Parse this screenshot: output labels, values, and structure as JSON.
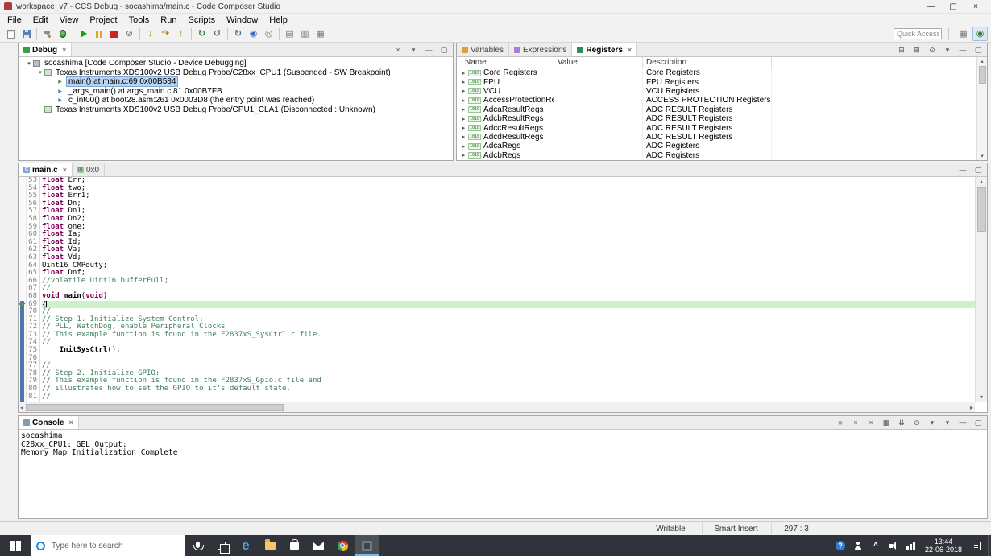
{
  "window": {
    "title": "workspace_v7 - CCS Debug - socashima/main.c - Code Composer Studio"
  },
  "titlebar": {
    "controls": [
      {
        "name": "minimize-button",
        "glyph": "—"
      },
      {
        "name": "maximize-button",
        "glyph": "▢"
      },
      {
        "name": "close-button",
        "glyph": "×"
      }
    ]
  },
  "menubar": {
    "items": [
      "File",
      "Edit",
      "View",
      "Project",
      "Tools",
      "Run",
      "Scripts",
      "Window",
      "Help"
    ]
  },
  "toolbar": {
    "quick_access_placeholder": "Quick Access",
    "groups": [
      [
        {
          "name": "new-button",
          "cls": "i-new"
        },
        {
          "name": "save-button",
          "cls": "i-save"
        }
      ],
      [
        {
          "name": "build-button",
          "cls": "i-hammer"
        },
        {
          "name": "debug-button",
          "cls": "i-bug"
        }
      ],
      [
        {
          "name": "resume-button",
          "cls": "i-play"
        },
        {
          "name": "suspend-button",
          "cls": "i-pause"
        },
        {
          "name": "terminate-button",
          "cls": "i-stop"
        },
        {
          "name": "disconnect-button",
          "glyph": "⊘",
          "color": "#8a8a8a"
        }
      ],
      [
        {
          "name": "step-into-button",
          "glyph": "↓",
          "color": "#b8860b"
        },
        {
          "name": "step-over-button",
          "glyph": "↷",
          "color": "#b8860b"
        },
        {
          "name": "step-return-button",
          "glyph": "↑",
          "color": "#b8860b"
        }
      ],
      [
        {
          "name": "restart-button",
          "glyph": "↻",
          "color": "#2e7d32"
        },
        {
          "name": "cpu-reset-button",
          "glyph": "↺",
          "color": "#666666"
        }
      ],
      [
        {
          "name": "refresh-button",
          "glyph": "↻",
          "color": "#4a6ea9"
        },
        {
          "name": "breakpoints-button",
          "glyph": "◉",
          "color": "#3a6fb5"
        },
        {
          "name": "watchpoint-button",
          "glyph": "◎",
          "color": "#777777"
        }
      ],
      [
        {
          "name": "memory-browser-button",
          "glyph": "▤",
          "color": "#777777"
        },
        {
          "name": "registers-view-button",
          "glyph": "▥",
          "color": "#777777"
        },
        {
          "name": "expressions-view-button",
          "glyph": "▦",
          "color": "#777777"
        }
      ]
    ],
    "perspectives": [
      {
        "name": "perspective-ccs-edit-button",
        "glyph": "▦",
        "color": "#777777",
        "active": false
      },
      {
        "name": "perspective-ccs-debug-button",
        "glyph": "◉",
        "color": "#2e7d32",
        "active": true
      }
    ]
  },
  "left_strip": {
    "icons": [
      {
        "name": "restore-views-button",
        "glyph": "◧"
      },
      {
        "name": "minimized-view-button-1",
        "glyph": "▤"
      },
      {
        "name": "minimized-view-button-2",
        "glyph": "▦"
      }
    ]
  },
  "debug_panel": {
    "tab": "Debug",
    "header_icons": [
      {
        "name": "remove-terminated-button",
        "glyph": "×"
      },
      {
        "name": "view-menu-button",
        "glyph": "▾"
      },
      {
        "name": "minimize-button",
        "glyph": "—"
      },
      {
        "name": "maximize-button",
        "glyph": "▢"
      }
    ],
    "tree": [
      {
        "indent": 0,
        "expander": "▾",
        "icon": "debug-target-icon",
        "selected": false,
        "text": "socashima [Code Composer Studio - Device Debugging]"
      },
      {
        "indent": 1,
        "expander": "▾",
        "icon": "cpu-probe-icon",
        "selected": false,
        "text": "Texas Instruments XDS100v2 USB Debug Probe/C28xx_CPU1 (Suspended - SW Breakpoint)"
      },
      {
        "indent": 2,
        "expander": "",
        "icon": "stack-frame-current-icon",
        "selected": true,
        "text": "main() at main.c:69 0x00B584"
      },
      {
        "indent": 2,
        "expander": "",
        "icon": "stack-frame-icon",
        "selected": false,
        "text": "_args_main() at args_main.c:81 0x00B7FB"
      },
      {
        "indent": 2,
        "expander": "",
        "icon": "stack-frame-icon",
        "selected": false,
        "text": "c_int00() at boot28.asm:261 0x0003D8 (the entry point was reached)"
      },
      {
        "indent": 1,
        "expander": "",
        "icon": "cpu-probe-icon",
        "selected": false,
        "text": "Texas Instruments XDS100v2 USB Debug Probe/CPU1_CLA1 (Disconnected : Unknown)"
      }
    ]
  },
  "registers_panel": {
    "tabs": [
      {
        "label": "Variables",
        "icon": "variables-icon",
        "active": false
      },
      {
        "label": "Expressions",
        "icon": "expressions-icon",
        "active": false
      },
      {
        "label": "Registers",
        "icon": "registers-icon",
        "active": true
      }
    ],
    "header_icons": [
      {
        "name": "collapse-all-button",
        "glyph": "⊟"
      },
      {
        "name": "expand-all-button",
        "glyph": "⊞"
      },
      {
        "name": "pin-view-button",
        "glyph": "⊙"
      },
      {
        "name": "view-menu-button",
        "glyph": "▾"
      },
      {
        "name": "minimize-button",
        "glyph": "—"
      },
      {
        "name": "maximize-button",
        "glyph": "▢"
      }
    ],
    "columns": [
      "Name",
      "Value",
      "Description"
    ],
    "rows": [
      {
        "name": "Core Registers",
        "value": "",
        "description": "Core Registers"
      },
      {
        "name": "FPU",
        "value": "",
        "description": "FPU Registers"
      },
      {
        "name": "VCU",
        "value": "",
        "description": "VCU Registers"
      },
      {
        "name": "AccessProtectionRegs",
        "value": "",
        "description": "ACCESS PROTECTION Registers"
      },
      {
        "name": "AdcaResultRegs",
        "value": "",
        "description": "ADC RESULT Registers"
      },
      {
        "name": "AdcbResultRegs",
        "value": "",
        "description": "ADC RESULT Registers"
      },
      {
        "name": "AdccResultRegs",
        "value": "",
        "description": "ADC RESULT Registers"
      },
      {
        "name": "AdcdResultRegs",
        "value": "",
        "description": "ADC RESULT Registers"
      },
      {
        "name": "AdcaRegs",
        "value": "",
        "description": "ADC Registers"
      },
      {
        "name": "AdcbRegs",
        "value": "",
        "description": "ADC Registers"
      }
    ]
  },
  "editor": {
    "tabs": [
      {
        "label": "main.c",
        "icon": "c-file-icon",
        "active": true,
        "closable": true
      },
      {
        "label": "0x0",
        "icon": "disassembly-icon",
        "active": false,
        "closable": false
      }
    ],
    "header_icons": [
      {
        "name": "minimize-button",
        "glyph": "—"
      },
      {
        "name": "maximize-button",
        "glyph": "▢"
      }
    ],
    "lines": [
      {
        "n": 53,
        "t": "float Err;",
        "current": false
      },
      {
        "n": 54,
        "t": "float two;",
        "current": false
      },
      {
        "n": 55,
        "t": "float Err1;",
        "current": false
      },
      {
        "n": 56,
        "t": "float Dn;",
        "current": false
      },
      {
        "n": 57,
        "t": "float Dn1;",
        "current": false
      },
      {
        "n": 58,
        "t": "float Dn2;",
        "current": false
      },
      {
        "n": 59,
        "t": "float one;",
        "current": false
      },
      {
        "n": 60,
        "t": "float Ia;",
        "current": false
      },
      {
        "n": 61,
        "t": "float Id;",
        "current": false
      },
      {
        "n": 62,
        "t": "float Va;",
        "current": false
      },
      {
        "n": 63,
        "t": "float Vd;",
        "current": false
      },
      {
        "n": 64,
        "t": "Uint16 CMPduty;",
        "current": false
      },
      {
        "n": 65,
        "t": "float Dnf;",
        "current": false
      },
      {
        "n": 66,
        "t": "//volatile Uint16 bufferFull;",
        "current": false
      },
      {
        "n": 67,
        "t": "//",
        "current": false
      },
      {
        "n": 68,
        "t": "void main(void)",
        "current": false
      },
      {
        "n": 69,
        "t": "{",
        "current": true
      },
      {
        "n": 70,
        "t": "//",
        "current": false
      },
      {
        "n": 71,
        "t": "// Step 1. Initialize System Control:",
        "current": false
      },
      {
        "n": 72,
        "t": "// PLL, WatchDog, enable Peripheral Clocks",
        "current": false
      },
      {
        "n": 73,
        "t": "// This example function is found in the F2837xS_SysCtrl.c file.",
        "current": false
      },
      {
        "n": 74,
        "t": "//",
        "current": false
      },
      {
        "n": 75,
        "t": "    InitSysCtrl();",
        "current": false
      },
      {
        "n": 76,
        "t": "",
        "current": false
      },
      {
        "n": 77,
        "t": "//",
        "current": false
      },
      {
        "n": 78,
        "t": "// Step 2. Initialize GPIO:",
        "current": false
      },
      {
        "n": 79,
        "t": "// This example function is found in the F2837xS_Gpio.c file and",
        "current": false
      },
      {
        "n": 80,
        "t": "// illustrates how to set the GPIO to it's default state.",
        "current": false
      },
      {
        "n": 81,
        "t": "//",
        "current": false
      }
    ]
  },
  "console": {
    "tab": "Console",
    "header_icons": [
      {
        "name": "terminate-button",
        "glyph": "■",
        "color": "#c49a9a"
      },
      {
        "name": "remove-launch-button",
        "glyph": "×"
      },
      {
        "name": "remove-all-launches-button",
        "glyph": "×"
      },
      {
        "name": "clear-console-button",
        "glyph": "▦"
      },
      {
        "name": "scroll-lock-button",
        "glyph": "⇊"
      },
      {
        "name": "pin-console-button",
        "glyph": "⊙"
      },
      {
        "name": "console-display-button",
        "glyph": "▾"
      },
      {
        "name": "open-console-button",
        "glyph": "▾"
      },
      {
        "name": "minimize-button",
        "glyph": "—"
      },
      {
        "name": "maximize-button",
        "glyph": "▢"
      }
    ],
    "lines": [
      "socashima",
      "C28xx_CPU1: GEL Output:",
      "Memory Map Initialization Complete"
    ]
  },
  "statusbar": {
    "writable": "Writable",
    "insert_mode": "Smart Insert",
    "caret_position": "297 : 3"
  },
  "taskbar": {
    "search_placeholder": "Type here to search",
    "icons": [
      {
        "name": "mic-button",
        "cls": "tb-mic",
        "active": false
      },
      {
        "name": "task-view-button",
        "cls": "tb-taskview",
        "active": false
      },
      {
        "name": "edge-button",
        "cls": "tb-edge",
        "label": "e",
        "active": false
      },
      {
        "name": "file-explorer-button",
        "cls": "tb-folder",
        "active": false
      },
      {
        "name": "store-button",
        "cls": "tb-store",
        "active": false
      },
      {
        "name": "mail-button",
        "cls": "tb-mail",
        "active": false
      },
      {
        "name": "chrome-button",
        "cls": "tb-chrome",
        "active": false
      },
      {
        "name": "ccs-button",
        "cls": "tb-ccs",
        "active": true
      }
    ],
    "tray": [
      {
        "name": "help-button",
        "cls": "tb-help",
        "label": "?"
      },
      {
        "name": "people-button",
        "cls": "tb-people"
      },
      {
        "name": "hidden-icons-button",
        "cls": "tb-chevron",
        "label": "^"
      },
      {
        "name": "volume-button",
        "cls": "tb-vol"
      },
      {
        "name": "network-button",
        "cls": "tb-net"
      }
    ],
    "time": "13:44",
    "date": "22-06-2018"
  },
  "colors": {
    "keyword": "#7f0055",
    "comment": "#3f7f5f",
    "debug_current_line_bg": "#cdf0cd",
    "selection_bg": "#b8d4f0"
  }
}
